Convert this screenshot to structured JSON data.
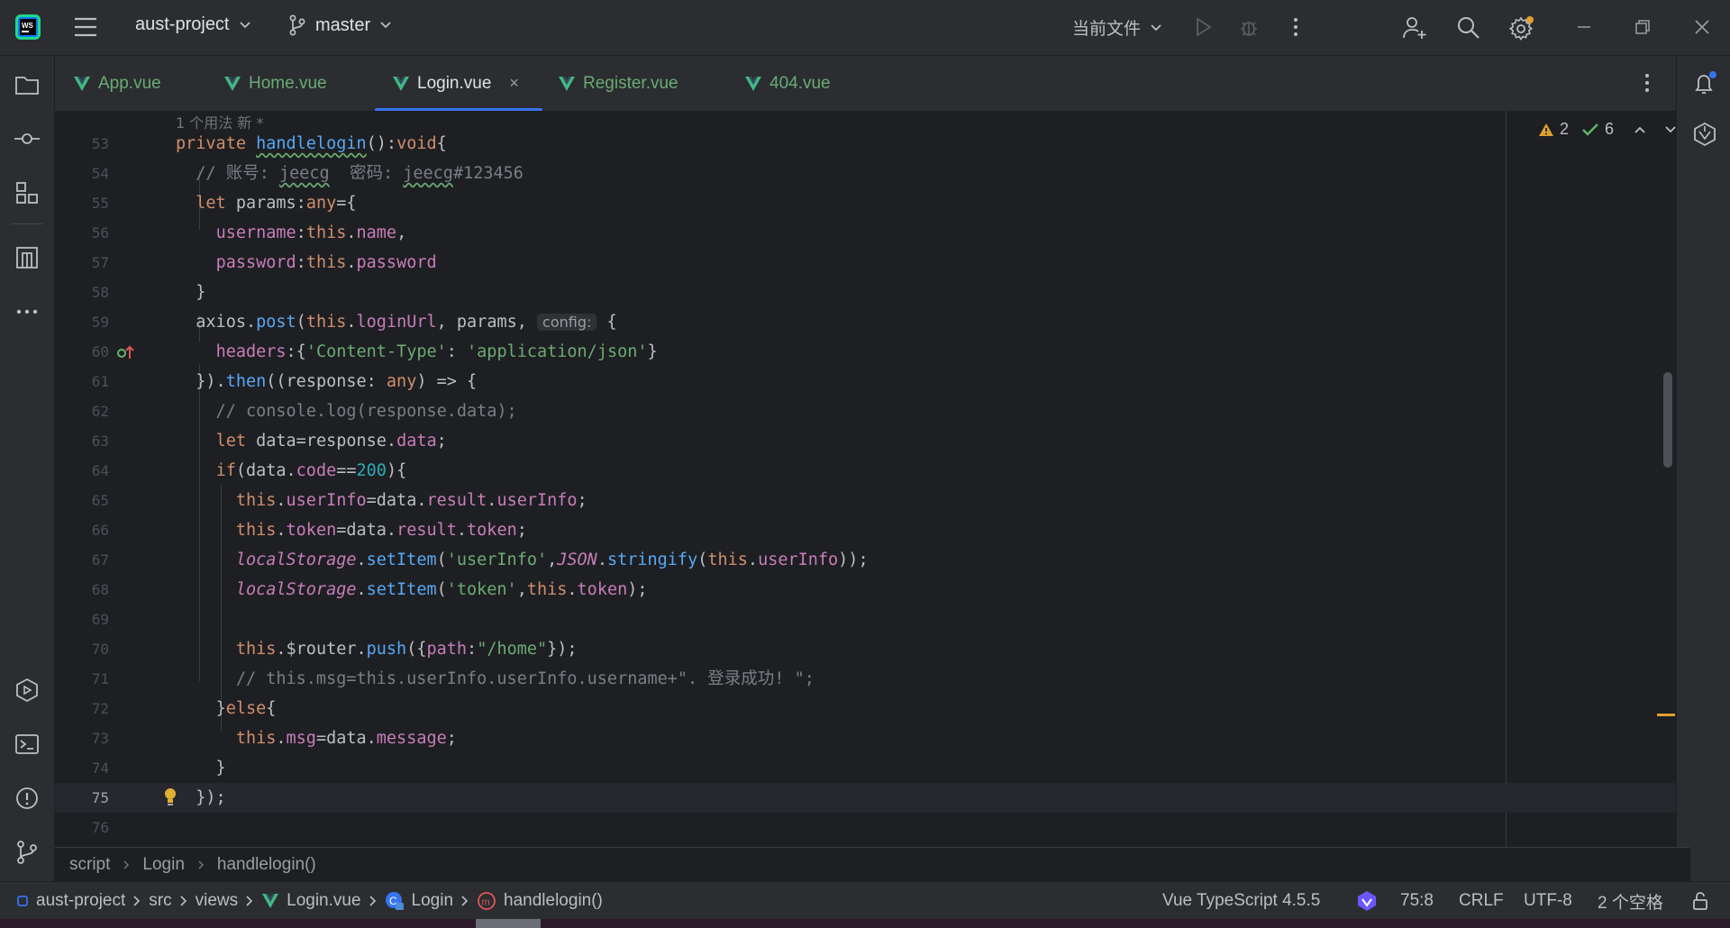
{
  "titlebar": {
    "project": "aust-project",
    "branch": "master",
    "run_config": "当前文件"
  },
  "tabs": [
    {
      "label": "App.vue",
      "active": false
    },
    {
      "label": "Home.vue",
      "active": false
    },
    {
      "label": "Login.vue",
      "active": true,
      "close": "×"
    },
    {
      "label": "Register.vue",
      "active": false
    },
    {
      "label": "404.vue",
      "active": false
    }
  ],
  "editor": {
    "usage_hint": "1 个用法   新 *",
    "inspections": {
      "warnings": "2",
      "checks": "6"
    },
    "current_line": "75",
    "lines": [
      {
        "num": "53",
        "text": "private handlelogin():void{"
      },
      {
        "num": "54",
        "text": "// 账号: jeecg  密码: jeecg#123456"
      },
      {
        "num": "55",
        "text": "let params:any={"
      },
      {
        "num": "56",
        "text": "username:this.name,"
      },
      {
        "num": "57",
        "text": "password:this.password"
      },
      {
        "num": "58",
        "text": "}"
      },
      {
        "num": "59",
        "text": "axios.post(this.loginUrl, params, config: {"
      },
      {
        "num": "60",
        "text": "headers:{'Content-Type': 'application/json'}"
      },
      {
        "num": "61",
        "text": "}).then((response: any) => {"
      },
      {
        "num": "62",
        "text": "// console.log(response.data);"
      },
      {
        "num": "63",
        "text": "let data=response.data;"
      },
      {
        "num": "64",
        "text": "if(data.code==200){"
      },
      {
        "num": "65",
        "text": "this.userInfo=data.result.userInfo;"
      },
      {
        "num": "66",
        "text": "this.token=data.result.token;"
      },
      {
        "num": "67",
        "text": "localStorage.setItem('userInfo',JSON.stringify(this.userInfo));"
      },
      {
        "num": "68",
        "text": "localStorage.setItem('token',this.token);"
      },
      {
        "num": "69",
        "text": ""
      },
      {
        "num": "70",
        "text": "this.$router.push({path:\"/home\"});"
      },
      {
        "num": "71",
        "text": "// this.msg=this.userInfo.userInfo.username+\". 登录成功! \";"
      },
      {
        "num": "72",
        "text": "}else{"
      },
      {
        "num": "73",
        "text": "this.msg=data.message;"
      },
      {
        "num": "74",
        "text": "}"
      },
      {
        "num": "75",
        "text": "});"
      },
      {
        "num": "76",
        "text": ""
      }
    ]
  },
  "breadcrumb": [
    "script",
    "Login",
    "handlelogin()"
  ],
  "statusbar": {
    "path": [
      "aust-project",
      "src",
      "views",
      "Login.vue",
      "Login",
      "handlelogin()"
    ],
    "language": "Vue TypeScript 4.5.5",
    "position": "75:8",
    "line_ending": "CRLF",
    "encoding": "UTF-8",
    "indent": "2 个空格"
  }
}
